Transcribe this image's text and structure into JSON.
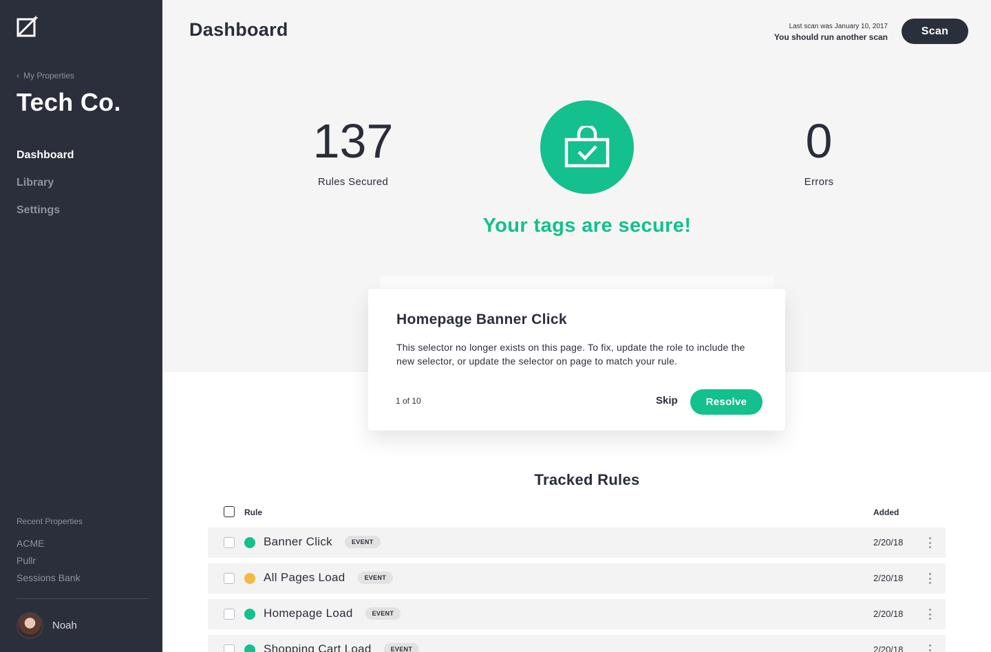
{
  "sidebar": {
    "back_label": "My Properties",
    "org_name": "Tech Co.",
    "nav": [
      {
        "label": "Dashboard",
        "active": true
      },
      {
        "label": "Library",
        "active": false
      },
      {
        "label": "Settings",
        "active": false
      }
    ],
    "recent_label": "Recent Properties",
    "recent": [
      "ACME",
      "Pullr",
      "Sessions Bank"
    ],
    "user": {
      "name": "Noah"
    }
  },
  "header": {
    "title": "Dashboard",
    "last_scan": "Last scan was January 10, 2017",
    "scan_hint": "You should run another scan",
    "scan_label": "Scan"
  },
  "stats": {
    "rules_secured": {
      "value": "137",
      "label": "Rules Secured"
    },
    "errors": {
      "value": "0",
      "label": "Errors"
    }
  },
  "status_message": "Your tags are secure!",
  "card": {
    "title": "Homepage Banner Click",
    "body": "This selector no longer exists on this page. To fix, update the role to include the new selector, or update the selector on page to match your rule.",
    "counter": "1 of 10",
    "skip_label": "Skip",
    "resolve_label": "Resolve"
  },
  "table": {
    "title": "Tracked Rules",
    "columns": {
      "rule": "Rule",
      "added": "Added"
    },
    "rows": [
      {
        "name": "Banner Click",
        "badge": "EVENT",
        "date": "2/20/18",
        "status_color": "#13c08e"
      },
      {
        "name": "All Pages Load",
        "badge": "EVENT",
        "date": "2/20/18",
        "status_color": "#f5b941"
      },
      {
        "name": "Homepage Load",
        "badge": "EVENT",
        "date": "2/20/18",
        "status_color": "#13c08e"
      },
      {
        "name": "Shopping Cart Load",
        "badge": "EVENT",
        "date": "2/20/18",
        "status_color": "#13c08e"
      }
    ]
  },
  "colors": {
    "sidebar_bg": "#2b2f3b",
    "accent_green": "#13c08e",
    "warning_yellow": "#f5b941",
    "text_dark": "#2a2e3a"
  },
  "icons": {
    "logo": "slash-box-logo-icon",
    "back": "chevron-left-icon",
    "lock": "lock-check-icon",
    "more": "more-vertical-icon"
  }
}
